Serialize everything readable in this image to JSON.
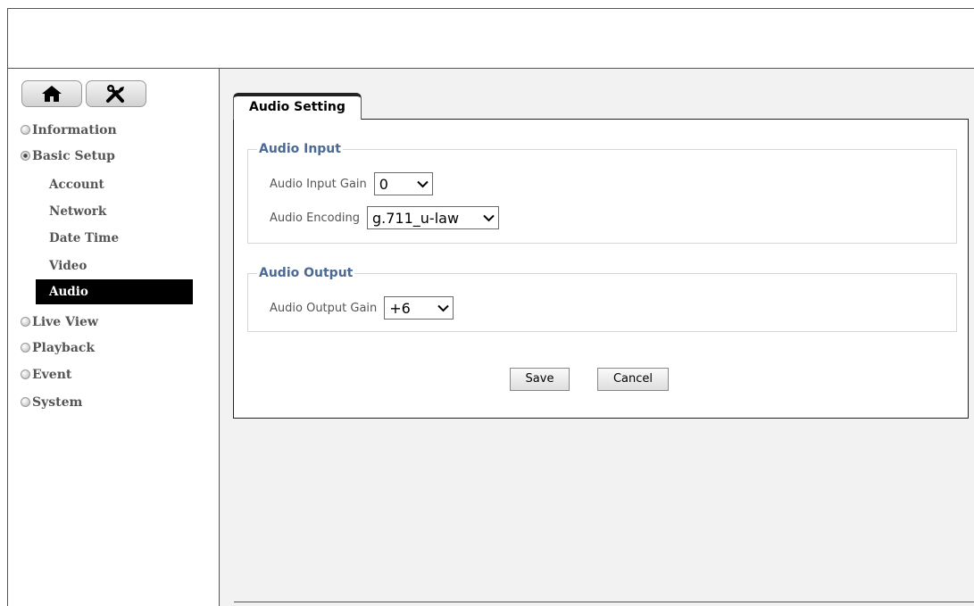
{
  "sidebar": {
    "menu": [
      {
        "label": "Information",
        "state": "closed"
      },
      {
        "label": "Basic Setup",
        "state": "open"
      },
      {
        "label": "Live View",
        "state": "closed"
      },
      {
        "label": "Playback",
        "state": "closed"
      },
      {
        "label": "Event",
        "state": "closed"
      },
      {
        "label": "System",
        "state": "closed"
      }
    ],
    "submenu": [
      {
        "label": "Account"
      },
      {
        "label": "Network"
      },
      {
        "label": "Date Time"
      },
      {
        "label": "Video"
      },
      {
        "label": "Audio",
        "active": true
      }
    ],
    "icons": [
      "home-icon",
      "tools-icon"
    ]
  },
  "main": {
    "tab_label": "Audio Setting",
    "audio_input": {
      "legend": "Audio Input",
      "gain_label": "Audio Input Gain",
      "gain_value": "0",
      "encoding_label": "Audio Encoding",
      "encoding_value": "g.711_u-law"
    },
    "audio_output": {
      "legend": "Audio Output",
      "gain_label": "Audio Output Gain",
      "gain_value": "+6"
    },
    "save_label": "Save",
    "cancel_label": "Cancel"
  },
  "colors": {
    "legend": "#4b6a93",
    "active_menu_bg": "#000000",
    "content_bg": "#f2f2f2"
  }
}
